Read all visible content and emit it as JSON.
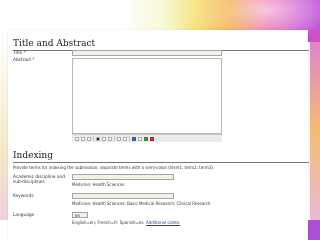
{
  "title_abstract": {
    "heading": "Title and Abstract",
    "title_label": "Title *",
    "abstract_label": "Abstract *",
    "toolbar_icons": [
      "cut-icon",
      "copy-icon",
      "paste-icon",
      "bold-icon",
      "italic-icon",
      "underline-icon",
      "bullet-list-icon",
      "numbered-list-icon",
      "link-icon",
      "unlink-icon",
      "image-icon",
      "html-icon"
    ]
  },
  "indexing": {
    "heading": "Indexing",
    "instructions": "Provide terms for indexing the submission; separate terms with a semi-colon (term1; term2; term3).",
    "discipline_label_line1": "Academic discipline and",
    "discipline_label_line2": "sub-disciplines",
    "discipline_hint": "Medicine; Health Sciences",
    "keywords_label": "Keywords",
    "keywords_hint": "Medicine; Health Sciences; Basic Medical Research; Clinical Research",
    "language_label": "Language",
    "language_value": "en",
    "language_hint": "English=en; French=fr; Spanish=es.",
    "language_link": "Additional codes."
  }
}
